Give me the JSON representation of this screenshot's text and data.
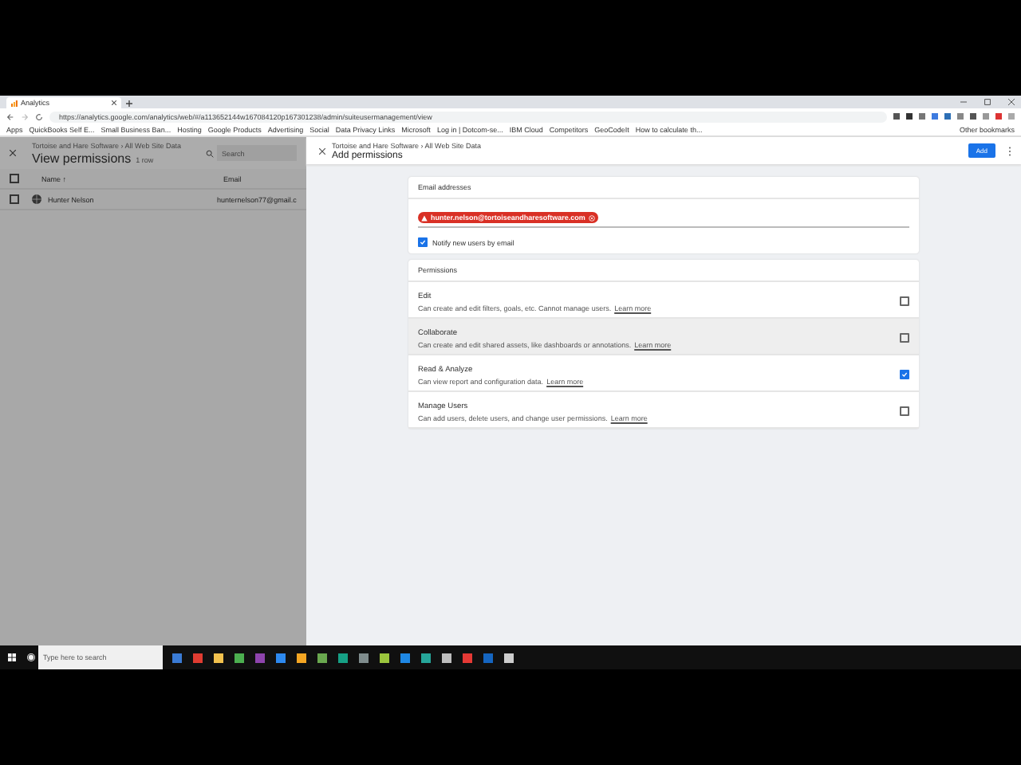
{
  "browser": {
    "tab_title": "Analytics",
    "url": "https://analytics.google.com/analytics/web/#/a113652144w167084120p167301238/admin/suiteusermanagement/view",
    "bookmarks": [
      "Apps",
      "QuickBooks Self E...",
      "Small Business Ban...",
      "Hosting",
      "Google Products",
      "Advertising",
      "Social",
      "Data Privacy Links",
      "Microsoft",
      "Log in | Dotcom-se...",
      "IBM Cloud",
      "Competitors",
      "GeoCodeIt",
      "How to calculate th..."
    ],
    "other_bookmarks": "Other bookmarks"
  },
  "view_panel": {
    "breadcrumb": "Tortoise and Hare Software › All Web Site Data",
    "title": "View permissions",
    "count": "1 row",
    "search_placeholder": "Search",
    "columns": [
      "Name ↑",
      "Email"
    ],
    "header_checked": false,
    "rows": [
      {
        "name": "Hunter Nelson",
        "email": "hunternelson77@gmail.c",
        "checked": false
      }
    ]
  },
  "add_panel": {
    "breadcrumb": "Tortoise and Hare Software › All Web Site Data",
    "title": "Add permissions",
    "add_button": "Add",
    "email_card": {
      "heading": "Email addresses",
      "chips": [
        {
          "text": "hunter.nelson@tortoiseandharesoftware.com",
          "error": true
        }
      ],
      "notify": {
        "label": "Notify new users by email",
        "checked": true
      }
    },
    "permissions_card": {
      "heading": "Permissions",
      "items": [
        {
          "name": "Edit",
          "description": "Can create and edit filters, goals, etc. Cannot manage users.",
          "link": "Learn more",
          "checked": false,
          "hovered": false
        },
        {
          "name": "Collaborate",
          "description": "Can create and edit shared assets, like dashboards or annotations.",
          "link": "Learn more",
          "checked": false,
          "hovered": true
        },
        {
          "name": "Read & Analyze",
          "description": "Can view report and configuration data.",
          "link": "Learn more",
          "checked": true,
          "hovered": false
        },
        {
          "name": "Manage Users",
          "description": "Can add users, delete users, and change user permissions.",
          "link": "Learn more",
          "checked": false,
          "hovered": false
        }
      ]
    }
  },
  "taskbar": {
    "search_placeholder": "Type here to search"
  }
}
